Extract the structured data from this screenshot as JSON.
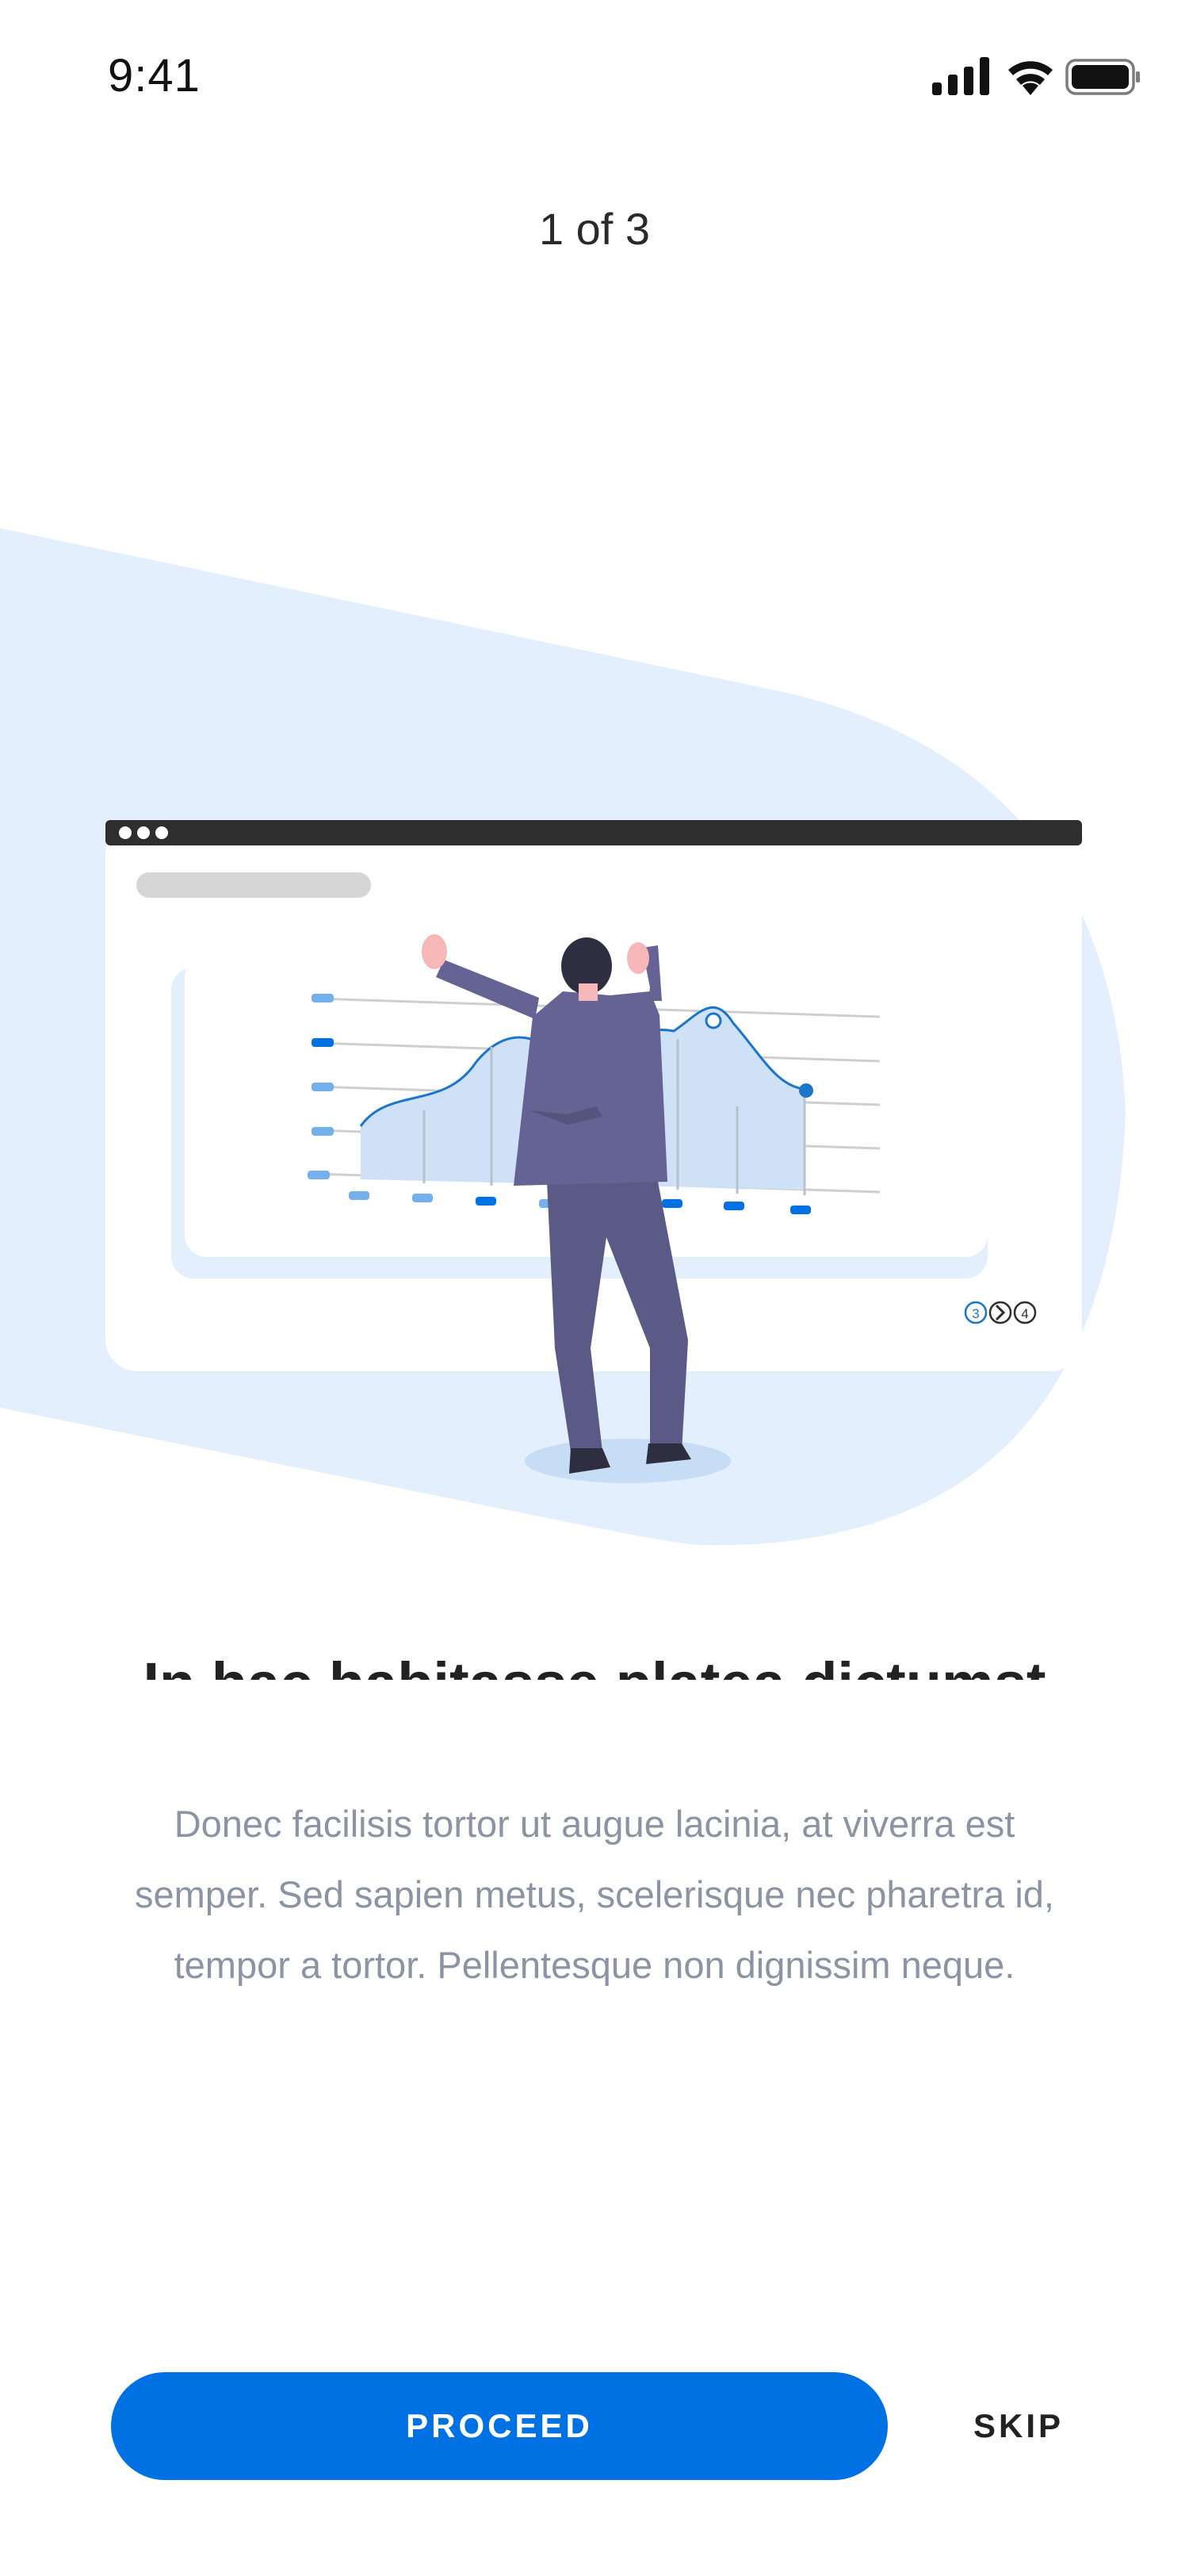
{
  "status_bar": {
    "time": "9:41",
    "icons": [
      "signal-icon",
      "wifi-icon",
      "battery-icon"
    ]
  },
  "pager": {
    "counter_text": "1 of 3"
  },
  "illustration": {
    "name": "person-analyzing-chart-illustration",
    "mini_pagination": [
      "3",
      "4"
    ],
    "colors": {
      "backdrop": "#e3effc",
      "browser_bar": "#2f2e2e",
      "chart_area": "#cfe1f7",
      "chart_line": "#1b76c9",
      "accent": "#0071e3",
      "figure_suit": "#5b5a86"
    }
  },
  "content": {
    "headline": "In hac habitasse platea dictumst",
    "body": "Donec facilisis tortor ut augue lacinia, at viverra est semper. Sed sapien metus, scelerisque nec pharetra id, tempor a tortor. Pellentesque non dignissim neque."
  },
  "actions": {
    "proceed_label": "PROCEED",
    "skip_label": "SKIP"
  },
  "colors": {
    "primary": "#0071e3",
    "body_text": "#8c93a3",
    "background": "#ffffff"
  }
}
